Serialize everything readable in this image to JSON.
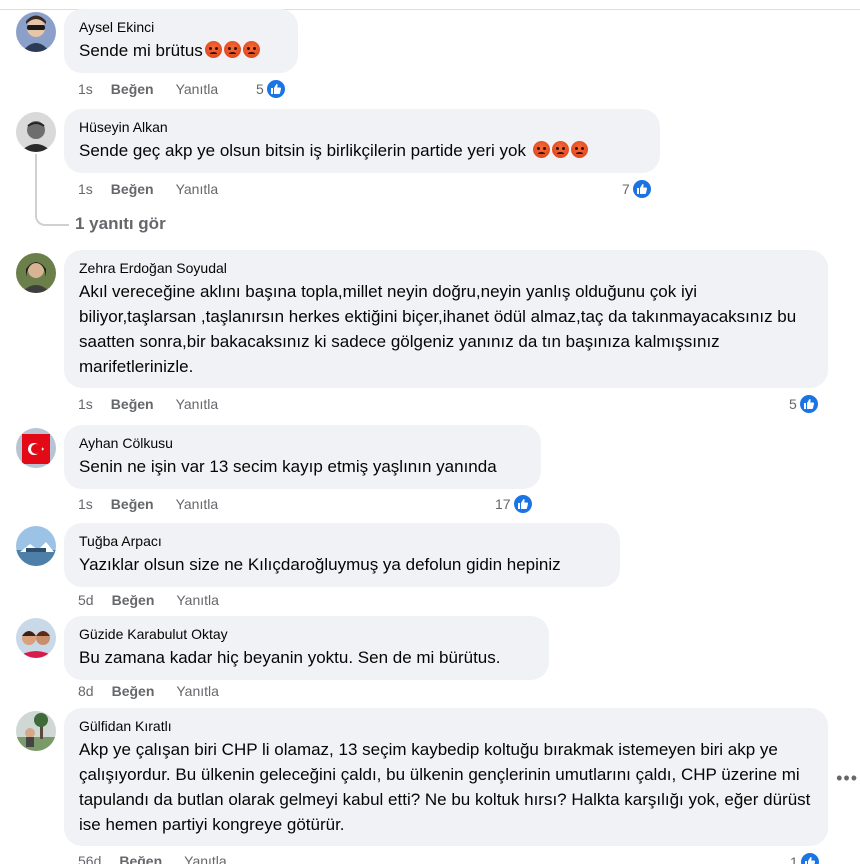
{
  "reactions": {
    "angry_emoji": "angry-emoji",
    "like_color": "#1b74e4"
  },
  "actions": {
    "like": "Beğen",
    "reply": "Yanıtla"
  },
  "comments": [
    {
      "author": "Aysel Ekinci",
      "text": "Sende mi brütus",
      "time": "1s",
      "likes": "5"
    },
    {
      "author": "Hüseyin Alkan",
      "text": "Sende geç akp ye olsun bitsin iş birlikçilerin partide yeri yok",
      "time": "1s",
      "likes": "7"
    },
    {
      "author": "Zehra Erdoğan Soyudal",
      "text": "Akıl vereceğine aklını başına topla,millet neyin doğru,neyin yanlış olduğunu çok iyi biliyor,taşlarsan ,taşlanırsın herkes ektiğini biçer,ihanet ödül almaz,taç da takınmayacaksınız bu saatten sonra,bir bakacaksınız ki sadece gölgeniz yanınız da tın başınıza kalmışsınız marifetlerinizle.",
      "time": "1s",
      "likes": "5"
    },
    {
      "author": "Ayhan Cölkusu",
      "text": "Senin ne işin var 13 secim kayıp etmiş yaşlının yanında",
      "time": "1s",
      "likes": "17"
    },
    {
      "author": "Tuğba Arpacı",
      "text": "Yazıklar olsun size ne Kılıçdaroğluymuş ya defolun gidin hepiniz",
      "time": "5d",
      "likes": ""
    },
    {
      "author": "Güzide Karabulut Oktay",
      "text": "Bu zamana kadar hiç beyanin yoktu. Sen de mi bürütus.",
      "time": "8d",
      "likes": ""
    },
    {
      "author": "Gülfidan Kıratlı",
      "text": "Akp ye çalışan biri CHP li olamaz, 13 seçim kaybedip koltuğu bırakmak istemeyen biri akp ye çalışıyordur. Bu ülkenin geleceğini çaldı, bu ülkenin gençlerinin umutlarını çaldı, CHP üzerine mi tapulandı da butlan olarak gelmeyi kabul etti? Ne bu koltuk hırsı? Halkta karşılığı yok, eğer dürüst ise hemen partiyi kongreye götürür.",
      "time": "56d",
      "likes": "1"
    }
  ],
  "view_replies": "1 yanıtı gör",
  "more_icon": "ellipsis-icon"
}
